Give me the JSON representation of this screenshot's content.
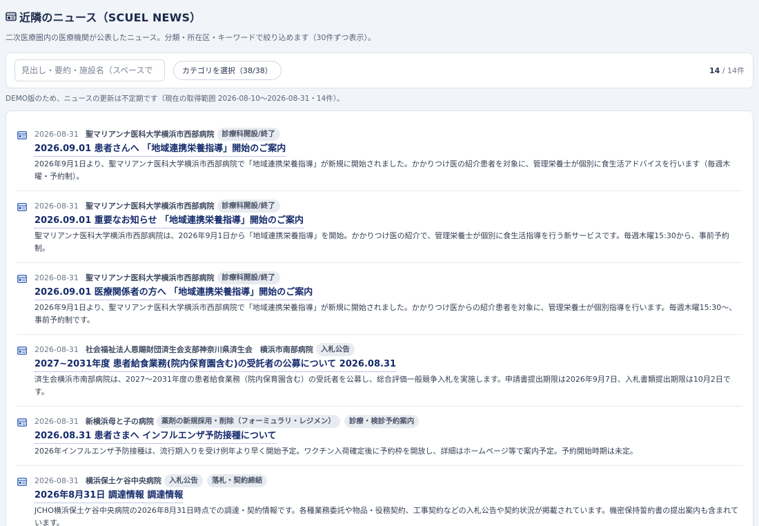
{
  "header": {
    "title": "近隣のニュース（SCUEL NEWS）",
    "description": "二次医療圏内の医療機関が公表したニュース。分類・所在区・キーワードで絞り込めます（30件ずつ表示）。"
  },
  "filters": {
    "search_placeholder": "見出し・要約・施設名（スペースで",
    "search_value": "",
    "category_label": "カテゴリを選択（38/38）",
    "count_current": "14",
    "count_total": "/ 14件"
  },
  "demo_note": "DEMO版のため、ニュースの更新は不定期です（現在の取得範囲 2026-08-10〜2026-08-31・14件）。",
  "news": [
    {
      "date": "2026-08-31",
      "facility": "聖マリアンナ医科大学横浜市西部病院",
      "tags": [
        "診療科開設/終了"
      ],
      "title": "2026.09.01 患者さんへ 「地域連携栄養指導」開始のご案内",
      "summary": "2026年9月1日より、聖マリアンナ医科大学横浜市西部病院で「地域連携栄養指導」が新規に開始されました。かかりつけ医の紹介患者を対象に、管理栄養士が個別に食生活アドバイスを行います（毎週木曜・予約制）。"
    },
    {
      "date": "2026-08-31",
      "facility": "聖マリアンナ医科大学横浜市西部病院",
      "tags": [
        "診療科開設/終了"
      ],
      "title": "2026.09.01 重要なお知らせ 「地域連携栄養指導」開始のご案内",
      "summary": "聖マリアンナ医科大学横浜市西部病院は、2026年9月1日から「地域連携栄養指導」を開始。かかりつけ医の紹介で、管理栄養士が個別に食生活指導を行う新サービスです。毎週木曜15:30から、事前予約制。"
    },
    {
      "date": "2026-08-31",
      "facility": "聖マリアンナ医科大学横浜市西部病院",
      "tags": [
        "診療科開設/終了"
      ],
      "title": "2026.09.01 医療関係者の方へ 「地域連携栄養指導」開始のご案内",
      "summary": "2026年9月1日より、聖マリアンナ医科大学横浜市西部病院で「地域連携栄養指導」が新規に開始されました。かかりつけ医からの紹介患者を対象に、管理栄養士が個別指導を行います。毎週木曜15:30〜、事前予約制です。"
    },
    {
      "date": "2026-08-31",
      "facility": "社会福祉法人恩賜財団済生会支部神奈川県済生会　横浜市南部病院",
      "tags": [
        "入札公告"
      ],
      "title": "2027~2031年度 患者給食業務(院内保育園含む)の受託者の公募について 2026.08.31",
      "summary": "済生会横浜市南部病院は、2027〜2031年度の患者給食業務（院内保育園含む）の受託者を公募し、総合評価一般競争入札を実施します。申請書提出期限は2026年9月7日、入札書類提出期限は10月2日です。"
    },
    {
      "date": "2026-08-31",
      "facility": "新横浜母と子の病院",
      "tags": [
        "薬剤の新規採用・削除（フォーミュラリ・レジメン）",
        "診療・検診予約案内"
      ],
      "title": "2026.08.31 患者さまへ インフルエンザ予防接種について",
      "summary": "2026年インフルエンザ予防接種は、流行期入りを受け例年より早く開始予定。ワクチン入荷確定後に予約枠を開放し、詳細はホームページ等で案内予定。予約開始時期は未定。"
    },
    {
      "date": "2026-08-31",
      "facility": "横浜保土ケ谷中央病院",
      "tags": [
        "入札公告",
        "落札・契約締結"
      ],
      "title": "2026年8月31日 調達情報 調達情報",
      "summary": "JCHO横浜保土ケ谷中央病院の2026年8月31日時点での調達・契約情報です。各種業務委託や物品・役務契約、工事契約などの入札公告や契約状況が掲載されています。機密保持誓約書の提出案内も含まれています。"
    }
  ],
  "icons": {
    "title": "newspaper-icon",
    "item": "news-item-icon"
  },
  "colors": {
    "accent": "#142a6b",
    "icon": "#3560b8",
    "background": "#f1f4f8"
  }
}
